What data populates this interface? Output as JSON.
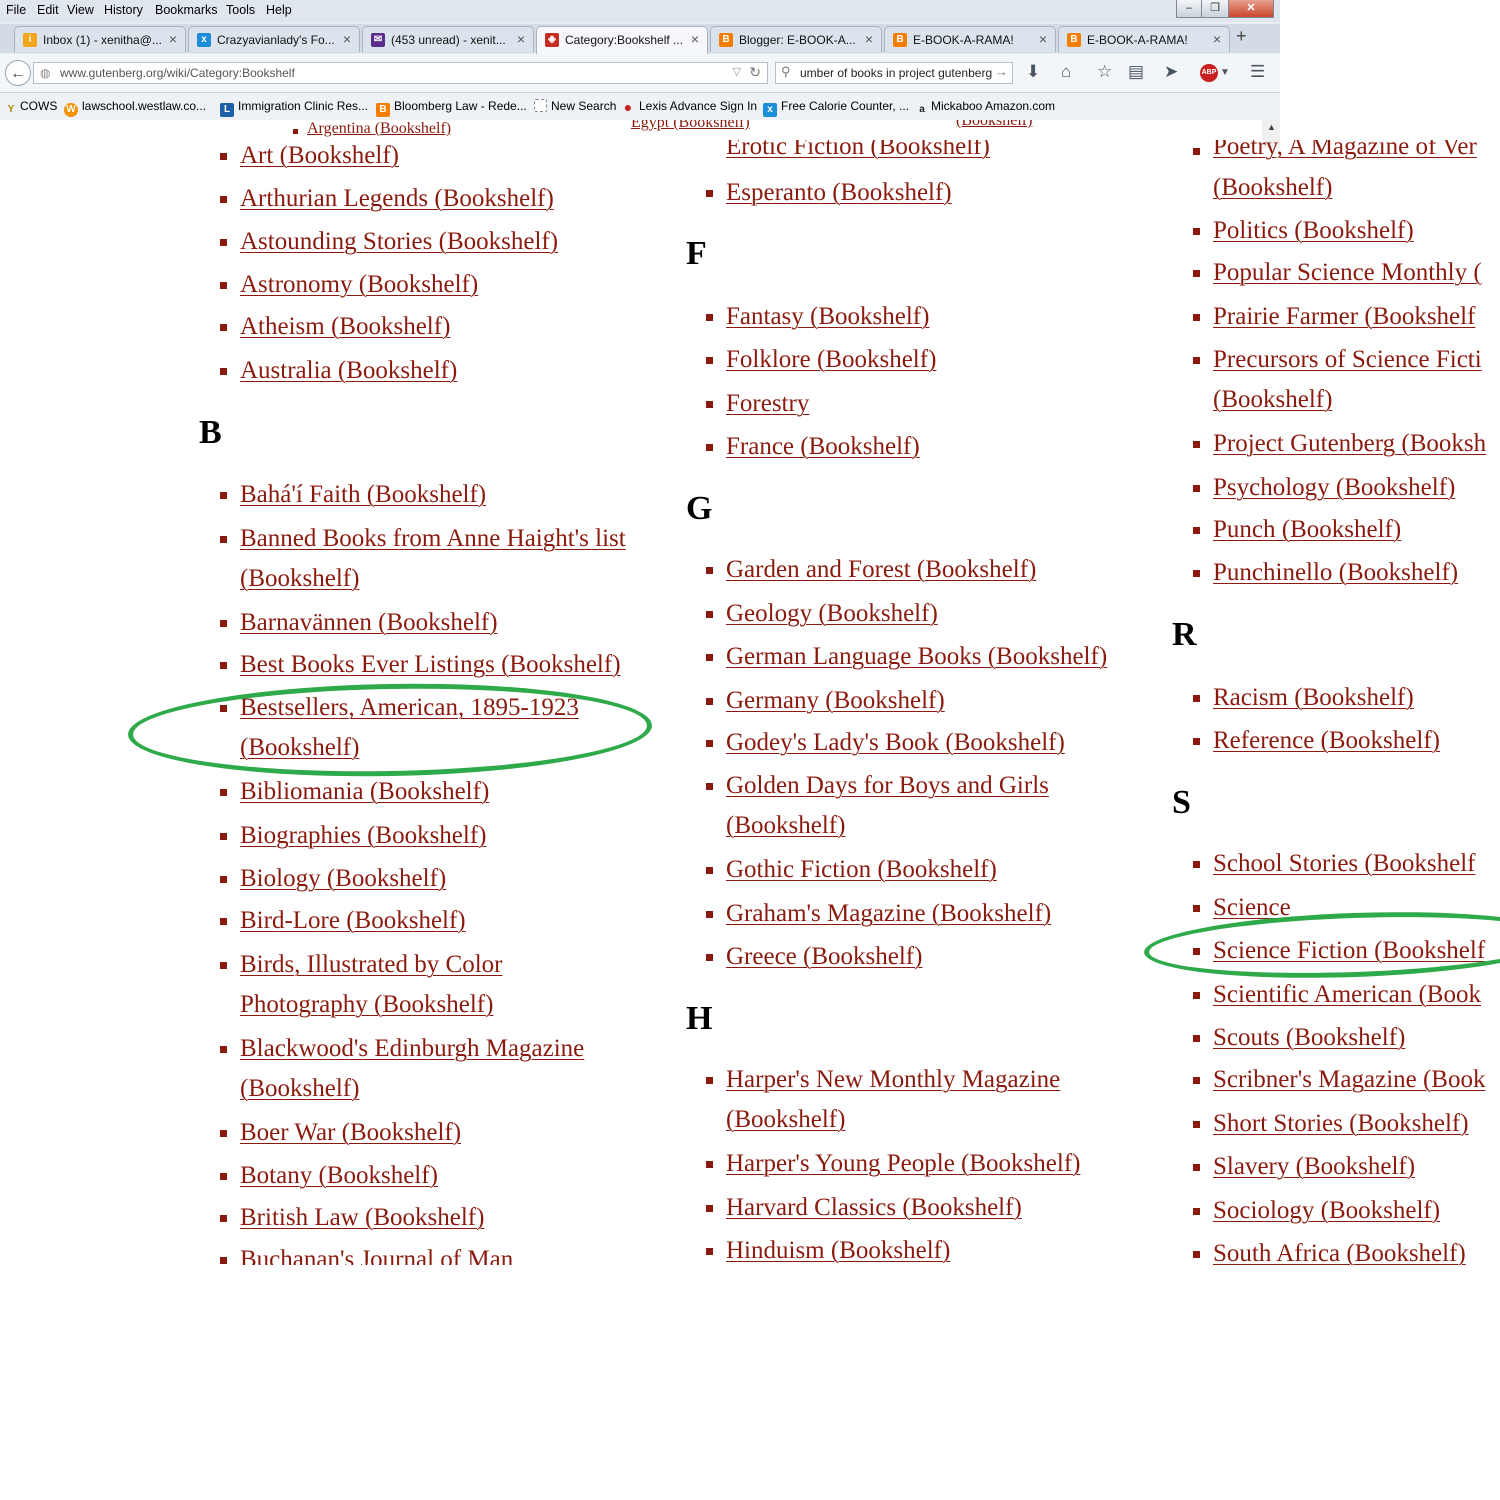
{
  "menu": [
    "File",
    "Edit",
    "View",
    "History",
    "Bookmarks",
    "Tools",
    "Help"
  ],
  "window": {
    "minimize": "–",
    "maximize": "❐",
    "close": "✕"
  },
  "tabs": [
    {
      "title": "Inbox (1) - xenitha@...",
      "icon_color": "#f2a51a",
      "icon": "i"
    },
    {
      "title": "Crazyavianlady's Fo...",
      "icon_color": "#1c8fd8",
      "icon": "x"
    },
    {
      "title": "(453 unread) - xenit...",
      "icon_color": "#5a2c8c",
      "icon": "✉"
    },
    {
      "title": "Category:Bookshelf ...",
      "icon_color": "#c72c20",
      "icon": "◈"
    },
    {
      "title": "Blogger: E-BOOK-A...",
      "icon_color": "#f57d00",
      "icon": "B"
    },
    {
      "title": "E-BOOK-A-RAMA!",
      "icon_color": "#f57d00",
      "icon": "B"
    },
    {
      "title": "E-BOOK-A-RAMA!",
      "icon_color": "#f57d00",
      "icon": "B"
    }
  ],
  "nav": {
    "url": "www.gutenberg.org/wiki/Category:Bookshelf",
    "search": "umber of books in project gutenberg"
  },
  "bookmarks": [
    {
      "label": "COWS",
      "icon": "Y",
      "color": "#b08a00"
    },
    {
      "label": "lawschool.westlaw.co...",
      "icon": "W",
      "color": "#f29100"
    },
    {
      "label": "Immigration Clinic Res...",
      "icon": "L",
      "color": "#1d5fa8"
    },
    {
      "label": "Bloomberg Law - Rede...",
      "icon": "B",
      "color": "#f57d00"
    },
    {
      "label": "New Search",
      "icon": "",
      "color": "#ffffff"
    },
    {
      "label": "Lexis Advance Sign In",
      "icon": "●",
      "color": "#c8201e"
    },
    {
      "label": "Free Calorie Counter, ...",
      "icon": "x",
      "color": "#1c8fd8"
    },
    {
      "label": "Mickaboo Amazon.com",
      "icon": "a",
      "color": "#222222"
    }
  ],
  "partial_top": {
    "col1": "Argentina (Bookshelf)",
    "col2": "Egypt (Bookshelf)",
    "col3": "(Bookshelf)",
    "col2_cut": "Erotic Fiction (Bookshelf)",
    "col3_cut": "Poetry, A Magazine of Ver"
  },
  "col1": {
    "items_a": [
      "Art (Bookshelf)",
      "Arthurian Legends (Bookshelf)",
      "Astounding Stories (Bookshelf)",
      "Astronomy (Bookshelf)",
      "Atheism (Bookshelf)",
      "Australia (Bookshelf)"
    ],
    "letter_b": "B",
    "items_b": [
      [
        "Bahá'í Faith (Bookshelf)"
      ],
      [
        "Banned Books from Anne Haight's list",
        "(Bookshelf)"
      ],
      [
        "Barnavännen (Bookshelf)"
      ],
      [
        "Best Books Ever Listings (Bookshelf)"
      ],
      [
        "Bestsellers, American, 1895-1923",
        "(Bookshelf)"
      ],
      [
        "Bibliomania (Bookshelf)"
      ],
      [
        "Biographies (Bookshelf)"
      ],
      [
        "Biology (Bookshelf)"
      ],
      [
        "Bird-Lore (Bookshelf)"
      ],
      [
        "Birds, Illustrated by Color",
        "Photography (Bookshelf)"
      ],
      [
        "Blackwood's Edinburgh Magazine",
        "(Bookshelf)"
      ],
      [
        "Boer War (Bookshelf)"
      ],
      [
        "Botany (Bookshelf)"
      ],
      [
        "British Law (Bookshelf)"
      ],
      [
        "Buchanan's Journal of Man"
      ]
    ]
  },
  "col2": {
    "items_e": [
      "Esperanto (Bookshelf)"
    ],
    "letter_f": "F",
    "items_f": [
      "Fantasy (Bookshelf)",
      "Folklore (Bookshelf)",
      "Forestry",
      "France (Bookshelf)"
    ],
    "letter_g": "G",
    "items_g": [
      [
        "Garden and Forest (Bookshelf)"
      ],
      [
        "Geology (Bookshelf)"
      ],
      [
        "German Language Books (Bookshelf)"
      ],
      [
        "Germany (Bookshelf)"
      ],
      [
        "Godey's Lady's Book (Bookshelf)"
      ],
      [
        "Golden Days for Boys and Girls",
        "(Bookshelf)"
      ],
      [
        "Gothic Fiction (Bookshelf)"
      ],
      [
        "Graham's Magazine (Bookshelf)"
      ],
      [
        "Greece (Bookshelf)"
      ]
    ],
    "letter_h": "H",
    "items_h": [
      [
        "Harper's New Monthly Magazine",
        "(Bookshelf)"
      ],
      [
        "Harper's Young People (Bookshelf)"
      ],
      [
        "Harvard Classics (Bookshelf)"
      ],
      [
        "Hinduism (Bookshelf)"
      ]
    ]
  },
  "col3": {
    "items_p": [
      [
        "",
        "(Bookshelf)"
      ],
      [
        "Politics (Bookshelf)"
      ],
      [
        "Popular Science Monthly ("
      ],
      [
        "Prairie Farmer (Bookshelf"
      ],
      [
        "Precursors of Science Ficti",
        "(Bookshelf)"
      ],
      [
        "Project Gutenberg (Booksh"
      ],
      [
        "Psychology (Bookshelf)"
      ],
      [
        "Punch (Bookshelf)"
      ],
      [
        "Punchinello (Bookshelf)"
      ]
    ],
    "letter_r": "R",
    "items_r": [
      "Racism (Bookshelf)",
      "Reference (Bookshelf)"
    ],
    "letter_s": "S",
    "items_s": [
      "School Stories (Bookshelf",
      "Science",
      "Science Fiction (Bookshelf",
      "Scientific American (Book",
      "Scouts (Bookshelf)",
      "Scribner's Magazine (Book",
      "Short Stories (Bookshelf)",
      "Slavery (Bookshelf)",
      "Sociology (Bookshelf)",
      "South Africa (Bookshelf)"
    ]
  },
  "highlight_color": "#2faa4a",
  "link_color": "#8b1a0e"
}
